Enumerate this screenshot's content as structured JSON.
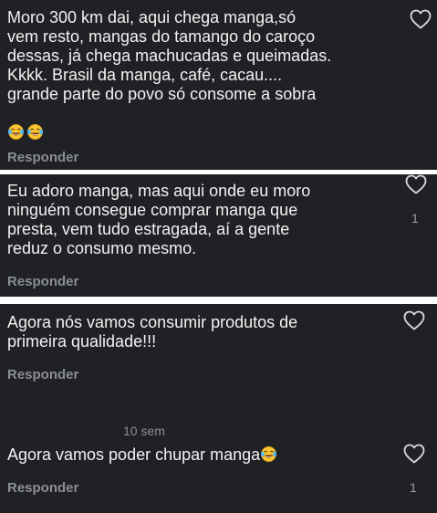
{
  "comments": [
    {
      "text": "Moro 300 km dai, aqui chega manga,só\nvem resto, mangas do tamango do caroço\ndessas, já chega machucadas e queimadas.\nKkkk. Brasil da manga, café, cacau....\ngrande parte do povo só consome a sobra",
      "emojis": [
        "tears-of-joy",
        "tears-of-joy"
      ],
      "reply_label": "Responder",
      "likes": ""
    },
    {
      "text": "Eu adoro manga, mas aqui onde eu moro\nninguém consegue comprar manga que\npresta, vem tudo estragada, aí a gente\nreduz o consumo mesmo.",
      "reply_label": "Responder",
      "likes": "1"
    },
    {
      "text": "Agora nós vamos consumir produtos de\nprimeira qualidade!!!",
      "reply_label": "Responder",
      "likes": ""
    },
    {
      "timestamp": "10 sem",
      "text": "Agora vamos poder chupar manga",
      "emojis": [
        "tears-of-joy"
      ],
      "reply_label": "Responder",
      "likes": "1"
    }
  ],
  "icons": {
    "like": "heart-outline-icon",
    "emoji": "face-with-tears-of-joy-icon"
  },
  "colors": {
    "card_bg": "#1f2125",
    "text": "#f2f2f2",
    "muted": "#8b8e93",
    "page_bg": "#ffffff"
  }
}
